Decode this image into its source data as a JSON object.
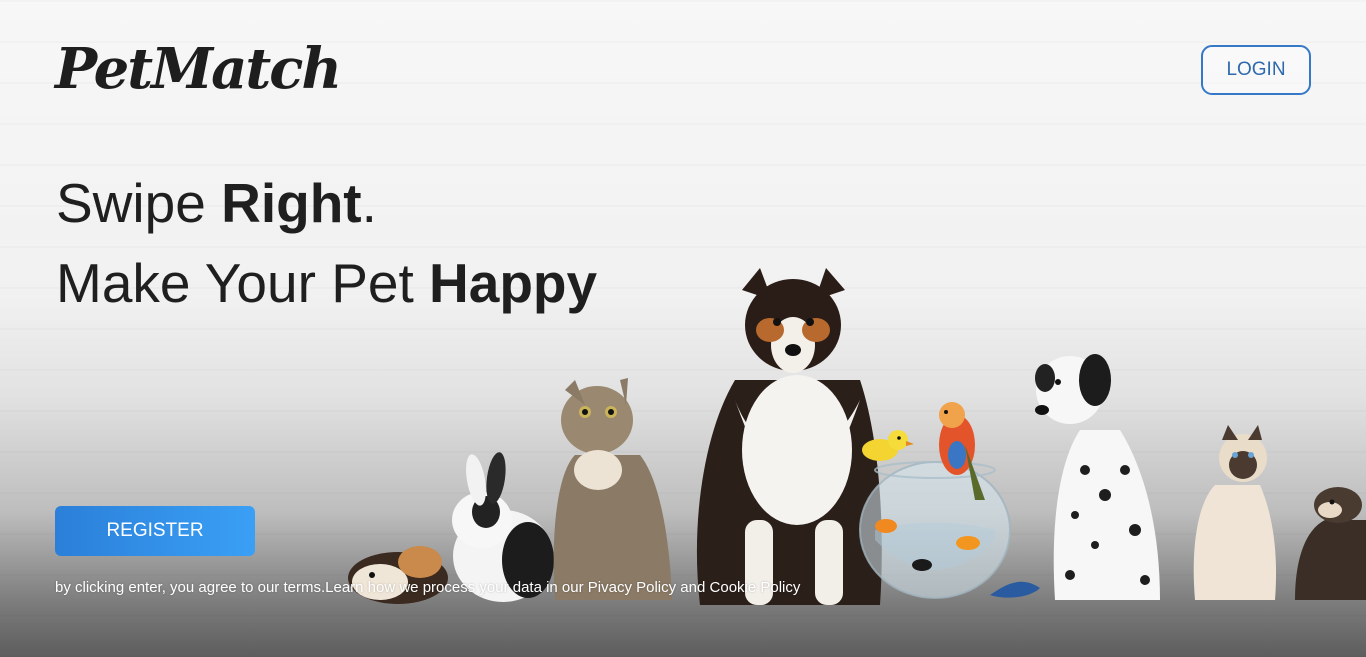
{
  "brand": {
    "name": "PetMatch"
  },
  "header": {
    "login_label": "LOGIN"
  },
  "hero": {
    "line1_prefix": "Swipe ",
    "line1_bold": "Right",
    "line1_suffix": ".",
    "line2_prefix": "Make Your Pet ",
    "line2_bold": "Happy"
  },
  "cta": {
    "register_label": "REGISTER"
  },
  "terms": {
    "text": "by clicking enter, you agree to our terms.Learn how we process your data in our ",
    "privacy_link": "Pivacy Policy",
    "and": " and ",
    "cookie_link": "Cookie Policy"
  },
  "colors": {
    "accent": "#3579c6",
    "register_start": "#2b7fd9",
    "register_end": "#3aa0f5",
    "text_dark": "#1f1f1f"
  },
  "image": {
    "subject": "pet-group-photo",
    "animals": [
      "guinea-pig",
      "rabbit",
      "tabby-cat",
      "collie-dog",
      "canary",
      "fish-bowl",
      "parrot",
      "dalmatian",
      "siamese-cat",
      "ferret"
    ]
  }
}
